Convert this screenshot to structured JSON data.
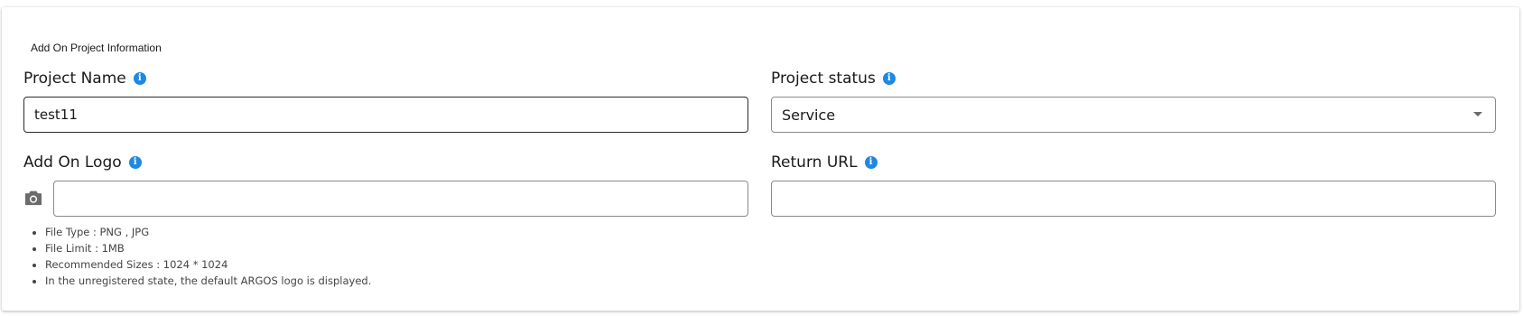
{
  "section": {
    "title": "Add On Project Information"
  },
  "fields": {
    "project_name": {
      "label": "Project Name",
      "value": "test11"
    },
    "project_status": {
      "label": "Project status",
      "value": "Service"
    },
    "add_on_logo": {
      "label": "Add On Logo",
      "value": ""
    },
    "return_url": {
      "label": "Return URL",
      "value": ""
    }
  },
  "logo_hints": [
    "File Type : PNG , JPG",
    "File Limit : 1MB",
    "Recommended Sizes : 1024 * 1024",
    "In the unregistered state, the default ARGOS logo is displayed."
  ],
  "icons": {
    "info": "info-icon",
    "camera": "camera-icon",
    "dropdown": "caret-down-icon"
  },
  "colors": {
    "info_icon": "#1e88e5",
    "focused_border": "#2b2b2b",
    "input_border": "#8a8a8a"
  }
}
